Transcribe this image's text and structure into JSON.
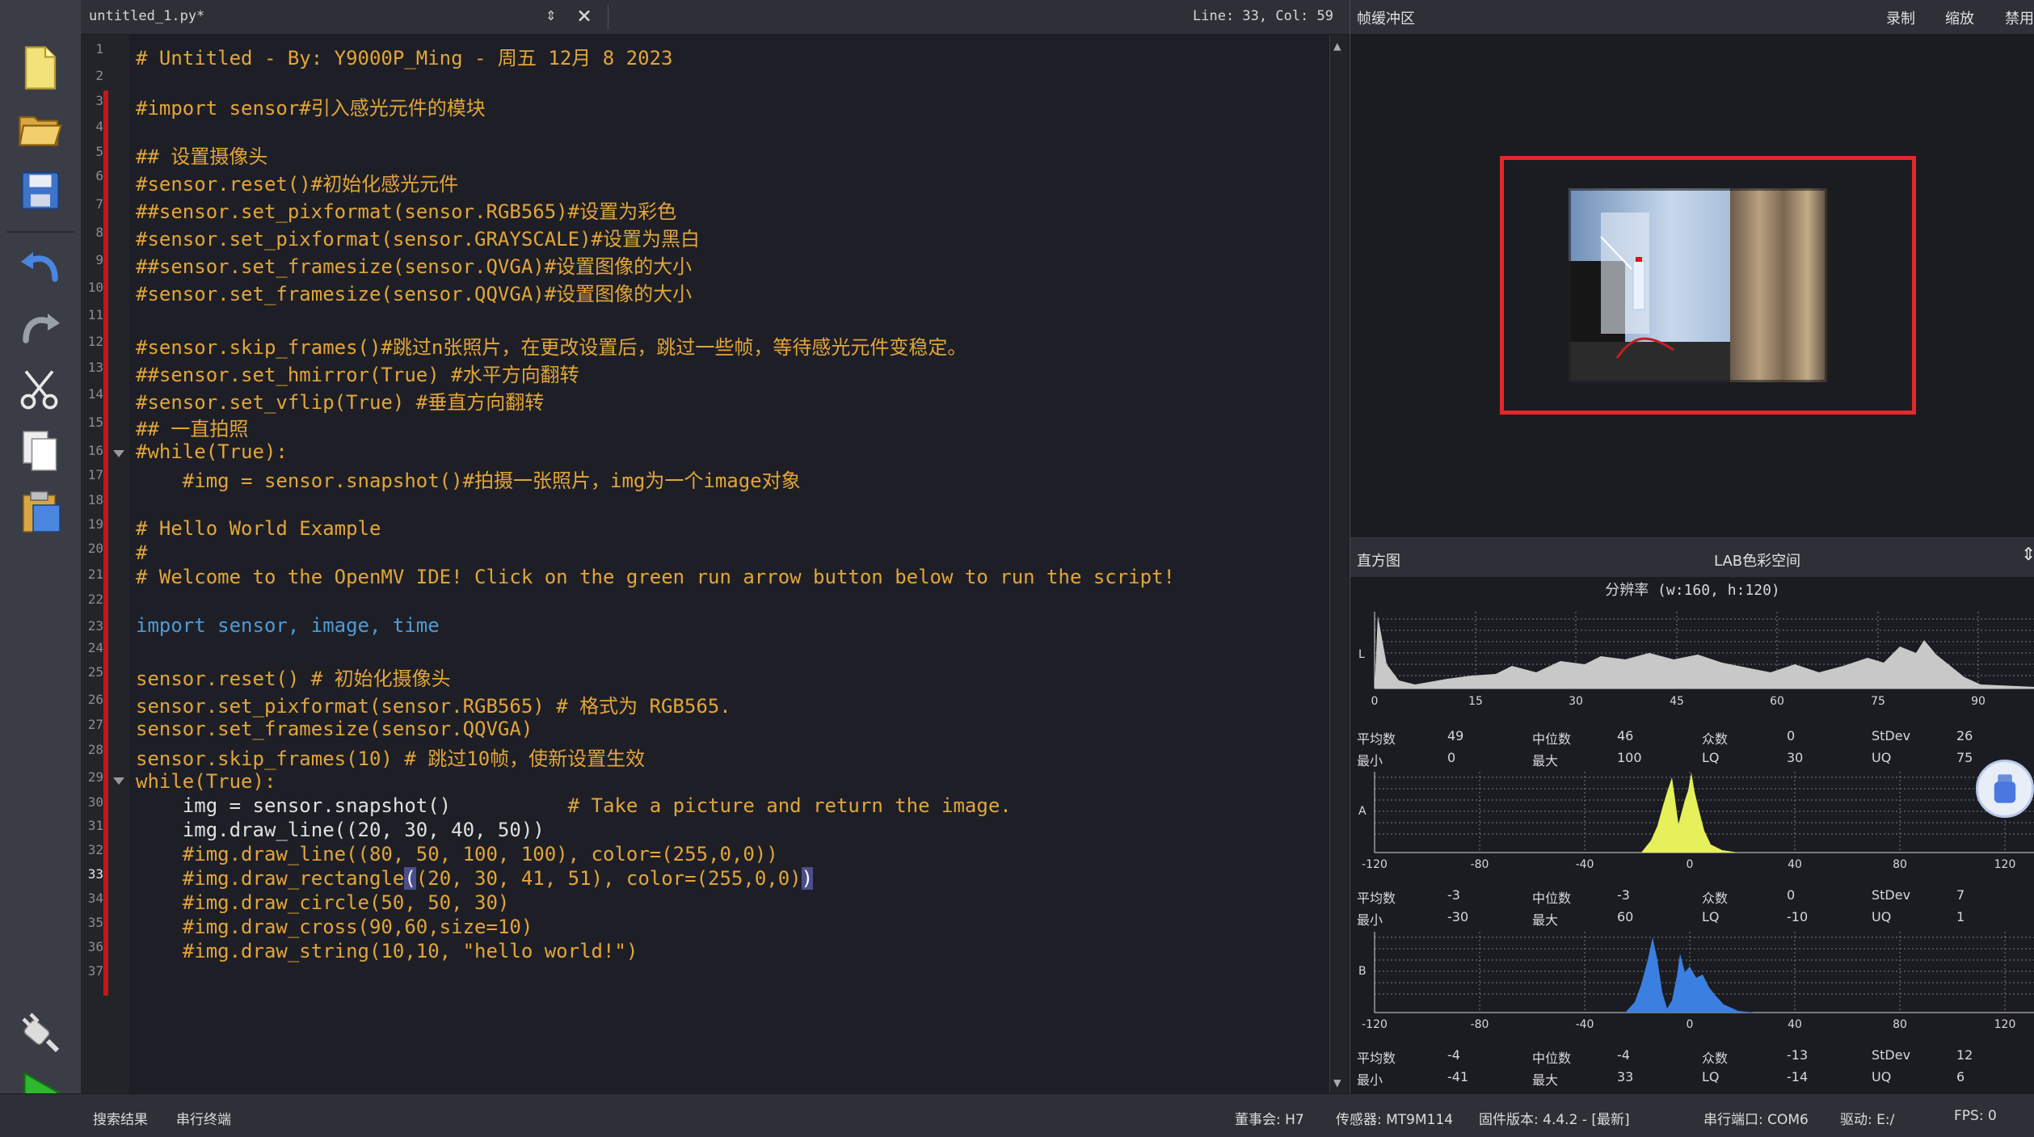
{
  "editor": {
    "filename": "untitled_1.py*",
    "position": "Line: 33, Col: 59",
    "line_numbers": [
      "1",
      "2",
      "3",
      "4",
      "5",
      "6",
      "7",
      "8",
      "9",
      "10",
      "11",
      "12",
      "13",
      "14",
      "15",
      "16",
      "17",
      "18",
      "19",
      "20",
      "21",
      "22",
      "23",
      "24",
      "25",
      "26",
      "27",
      "28",
      "29",
      "30",
      "31",
      "32",
      "33",
      "34",
      "35",
      "36",
      "37"
    ],
    "lines": [
      "# Untitled - By: Y9000P_Ming - 周五 12月 8 2023",
      "#import sensor#引入感光元件的模块",
      "## 设置摄像头",
      "#sensor.reset()#初始化感光元件",
      "##sensor.set_pixformat(sensor.RGB565)#设置为彩色",
      "#sensor.set_pixformat(sensor.GRAYSCALE)#设置为黑白",
      "##sensor.set_framesize(sensor.QVGA)#设置图像的大小",
      "#sensor.set_framesize(sensor.QQVGA)#设置图像的大小",
      "#sensor.skip_frames()#跳过n张照片，在更改设置后，跳过一些帧，等待感光元件变稳定。",
      "##sensor.set_hmirror(True) #水平方向翻转",
      "#sensor.set_vflip(True) #垂直方向翻转",
      "## 一直拍照",
      "#while(True):",
      "    #img = sensor.snapshot()#拍摄一张照片，img为一个image对象",
      "# Hello World Example",
      "#",
      "# Welcome to the OpenMV IDE! Click on the green run arrow button below to run the script!",
      "import",
      "sensor, image, time",
      "sensor.reset()",
      "# 初始化摄像头",
      "sensor.set_pixformat(sensor.RGB565)",
      "# 格式为 RGB565.",
      "sensor.set_framesize(sensor.QQVGA)",
      "sensor.skip_frames(10)",
      "# 跳过10帧，使新设置生效",
      "while(True):",
      "    img = sensor.snapshot()",
      "# Take a picture and return the image.",
      "    img.draw_line((20, 30, 40, 50))",
      "    #img.draw_line((80, 50, 100, 100), color=(255,0,0))",
      "    #img.draw_rectangle",
      "(",
      "(20, 30, 41, 51), color=(255,0,0)",
      ")",
      "    #img.draw_circle(50, 50, 30)",
      "    #img.draw_cross(90,60,size=10)",
      "    #img.draw_string(10,10, \"hello world!\")"
    ]
  },
  "framebuffer": {
    "title": "帧缓冲区",
    "record": "录制",
    "zoom": "缩放",
    "disable": "禁用"
  },
  "histogram": {
    "title": "直方图",
    "colorspace": "LAB色彩空间",
    "resolution": "分辨率 (w:160, h:120)",
    "labels": {
      "mean": "平均数",
      "median": "中位数",
      "mode": "众数",
      "stdev": "StDev",
      "min": "最小",
      "max": "最大",
      "lq": "LQ",
      "uq": "UQ"
    },
    "channels": [
      {
        "name": "L",
        "color": "#c8c8c8",
        "ticks": [
          "0",
          "15",
          "30",
          "45",
          "60",
          "75",
          "90"
        ],
        "mean": "49",
        "median": "46",
        "mode": "0",
        "stdev": "26",
        "min": "0",
        "max": "100",
        "lq": "30",
        "uq": "75"
      },
      {
        "name": "A",
        "color": "#e6f05a",
        "ticks": [
          "-120",
          "-80",
          "-40",
          "0",
          "40",
          "80",
          "120"
        ],
        "mean": "-3",
        "median": "-3",
        "mode": "0",
        "stdev": "7",
        "min": "-30",
        "max": "60",
        "lq": "-10",
        "uq": "1"
      },
      {
        "name": "B",
        "color": "#3b7fe0",
        "ticks": [
          "-120",
          "-80",
          "-40",
          "0",
          "40",
          "80",
          "120"
        ],
        "mean": "-4",
        "median": "-4",
        "mode": "-13",
        "stdev": "12",
        "min": "-41",
        "max": "33",
        "lq": "-14",
        "uq": "6"
      }
    ]
  },
  "statusbar": {
    "search": "搜索结果",
    "terminal": "串行终端",
    "board": "董事会: H7",
    "sensor": "传感器: MT9M114",
    "firmware": "固件版本: 4.4.2 - [最新]",
    "port": "串行端口: COM6",
    "drive": "驱动: E:/",
    "fps": "FPS: 0"
  },
  "icons": [
    "new-file-icon",
    "open-folder-icon",
    "save-icon",
    "undo-icon",
    "redo-icon",
    "cut-icon",
    "copy-icon",
    "paste-icon",
    "connect-icon",
    "run-icon",
    "usb-drive-icon"
  ]
}
